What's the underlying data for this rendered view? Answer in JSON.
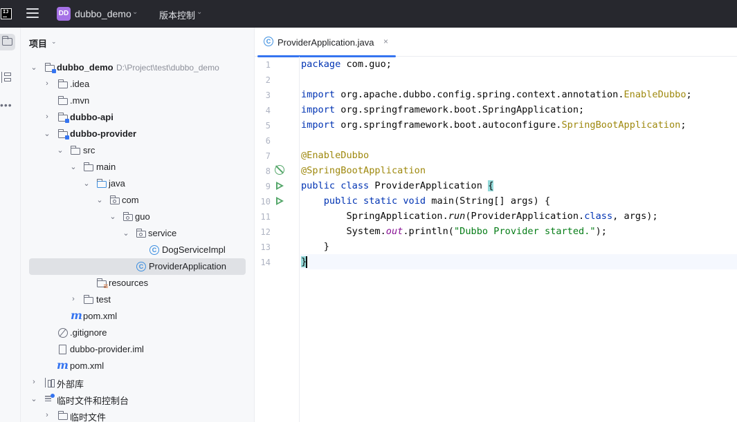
{
  "titlebar": {
    "project_badge": "DD",
    "project_name": "dubbo_demo",
    "vcs_label": "版本控制"
  },
  "project_panel": {
    "title": "项目",
    "tree": [
      {
        "label": "dubbo_demo",
        "hint": "D:\\Project\\test\\dubbo_demo"
      },
      {
        "label": ".idea"
      },
      {
        "label": ".mvn"
      },
      {
        "label": "dubbo-api"
      },
      {
        "label": "dubbo-provider"
      },
      {
        "label": "src"
      },
      {
        "label": "main"
      },
      {
        "label": "java"
      },
      {
        "label": "com"
      },
      {
        "label": "guo"
      },
      {
        "label": "service"
      },
      {
        "label": "DogServiceImpl"
      },
      {
        "label": "ProviderApplication"
      },
      {
        "label": "resources"
      },
      {
        "label": "test"
      },
      {
        "label": "pom.xml"
      },
      {
        "label": ".gitignore"
      },
      {
        "label": "dubbo-provider.iml"
      },
      {
        "label": "pom.xml"
      },
      {
        "label": "外部库"
      },
      {
        "label": "临时文件和控制台"
      },
      {
        "label": "临时文件"
      }
    ]
  },
  "editor": {
    "tab_label": "ProviderApplication.java",
    "tab_close": "×",
    "line_numbers": [
      "1",
      "2",
      "3",
      "4",
      "5",
      "6",
      "7",
      "8",
      "9",
      "10",
      "11",
      "12",
      "13",
      "14"
    ],
    "code": [
      [
        "package",
        " com.guo;"
      ],
      [
        ""
      ],
      [
        "import",
        " org.apache.dubbo.config.spring.context.annotation.",
        "EnableDubbo",
        ";"
      ],
      [
        "import",
        " org.springframework.boot.SpringApplication;"
      ],
      [
        "import",
        " org.springframework.boot.autoconfigure.",
        "SpringBootApplication",
        ";"
      ],
      [
        ""
      ],
      [
        "@EnableDubbo"
      ],
      [
        "@SpringBootApplication"
      ],
      [
        "public class",
        " ProviderApplication ",
        "{"
      ],
      [
        "    ",
        "public static void",
        " main(String[] args) {"
      ],
      [
        "        SpringApplication.",
        "run",
        "(ProviderApplication.",
        "class",
        ", args);"
      ],
      [
        "        System.",
        "out",
        ".println(",
        "\"Dubbo Provider started.\"",
        ");"
      ],
      [
        "    }"
      ],
      [
        "}"
      ]
    ]
  },
  "colors": {
    "keyword": "#0033b3",
    "annotation": "#9e880d",
    "string": "#067d17",
    "accent": "#3574f0",
    "run_icon": "#55a76a"
  }
}
